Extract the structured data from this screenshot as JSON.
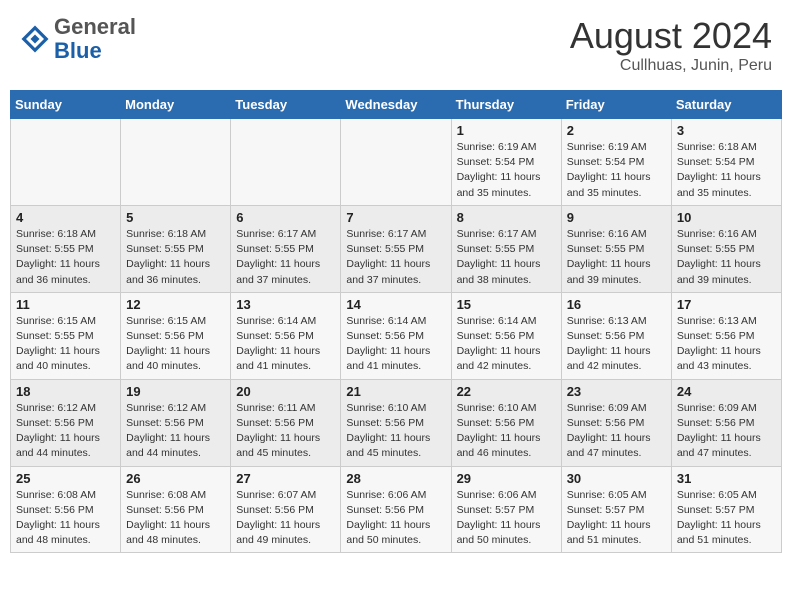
{
  "header": {
    "logo_general": "General",
    "logo_blue": "Blue",
    "month_year": "August 2024",
    "location": "Cullhuas, Junin, Peru"
  },
  "days_of_week": [
    "Sunday",
    "Monday",
    "Tuesday",
    "Wednesday",
    "Thursday",
    "Friday",
    "Saturday"
  ],
  "weeks": [
    [
      {
        "day": "",
        "info": ""
      },
      {
        "day": "",
        "info": ""
      },
      {
        "day": "",
        "info": ""
      },
      {
        "day": "",
        "info": ""
      },
      {
        "day": "1",
        "info": "Sunrise: 6:19 AM\nSunset: 5:54 PM\nDaylight: 11 hours\nand 35 minutes."
      },
      {
        "day": "2",
        "info": "Sunrise: 6:19 AM\nSunset: 5:54 PM\nDaylight: 11 hours\nand 35 minutes."
      },
      {
        "day": "3",
        "info": "Sunrise: 6:18 AM\nSunset: 5:54 PM\nDaylight: 11 hours\nand 35 minutes."
      }
    ],
    [
      {
        "day": "4",
        "info": "Sunrise: 6:18 AM\nSunset: 5:55 PM\nDaylight: 11 hours\nand 36 minutes."
      },
      {
        "day": "5",
        "info": "Sunrise: 6:18 AM\nSunset: 5:55 PM\nDaylight: 11 hours\nand 36 minutes."
      },
      {
        "day": "6",
        "info": "Sunrise: 6:17 AM\nSunset: 5:55 PM\nDaylight: 11 hours\nand 37 minutes."
      },
      {
        "day": "7",
        "info": "Sunrise: 6:17 AM\nSunset: 5:55 PM\nDaylight: 11 hours\nand 37 minutes."
      },
      {
        "day": "8",
        "info": "Sunrise: 6:17 AM\nSunset: 5:55 PM\nDaylight: 11 hours\nand 38 minutes."
      },
      {
        "day": "9",
        "info": "Sunrise: 6:16 AM\nSunset: 5:55 PM\nDaylight: 11 hours\nand 39 minutes."
      },
      {
        "day": "10",
        "info": "Sunrise: 6:16 AM\nSunset: 5:55 PM\nDaylight: 11 hours\nand 39 minutes."
      }
    ],
    [
      {
        "day": "11",
        "info": "Sunrise: 6:15 AM\nSunset: 5:55 PM\nDaylight: 11 hours\nand 40 minutes."
      },
      {
        "day": "12",
        "info": "Sunrise: 6:15 AM\nSunset: 5:56 PM\nDaylight: 11 hours\nand 40 minutes."
      },
      {
        "day": "13",
        "info": "Sunrise: 6:14 AM\nSunset: 5:56 PM\nDaylight: 11 hours\nand 41 minutes."
      },
      {
        "day": "14",
        "info": "Sunrise: 6:14 AM\nSunset: 5:56 PM\nDaylight: 11 hours\nand 41 minutes."
      },
      {
        "day": "15",
        "info": "Sunrise: 6:14 AM\nSunset: 5:56 PM\nDaylight: 11 hours\nand 42 minutes."
      },
      {
        "day": "16",
        "info": "Sunrise: 6:13 AM\nSunset: 5:56 PM\nDaylight: 11 hours\nand 42 minutes."
      },
      {
        "day": "17",
        "info": "Sunrise: 6:13 AM\nSunset: 5:56 PM\nDaylight: 11 hours\nand 43 minutes."
      }
    ],
    [
      {
        "day": "18",
        "info": "Sunrise: 6:12 AM\nSunset: 5:56 PM\nDaylight: 11 hours\nand 44 minutes."
      },
      {
        "day": "19",
        "info": "Sunrise: 6:12 AM\nSunset: 5:56 PM\nDaylight: 11 hours\nand 44 minutes."
      },
      {
        "day": "20",
        "info": "Sunrise: 6:11 AM\nSunset: 5:56 PM\nDaylight: 11 hours\nand 45 minutes."
      },
      {
        "day": "21",
        "info": "Sunrise: 6:10 AM\nSunset: 5:56 PM\nDaylight: 11 hours\nand 45 minutes."
      },
      {
        "day": "22",
        "info": "Sunrise: 6:10 AM\nSunset: 5:56 PM\nDaylight: 11 hours\nand 46 minutes."
      },
      {
        "day": "23",
        "info": "Sunrise: 6:09 AM\nSunset: 5:56 PM\nDaylight: 11 hours\nand 47 minutes."
      },
      {
        "day": "24",
        "info": "Sunrise: 6:09 AM\nSunset: 5:56 PM\nDaylight: 11 hours\nand 47 minutes."
      }
    ],
    [
      {
        "day": "25",
        "info": "Sunrise: 6:08 AM\nSunset: 5:56 PM\nDaylight: 11 hours\nand 48 minutes."
      },
      {
        "day": "26",
        "info": "Sunrise: 6:08 AM\nSunset: 5:56 PM\nDaylight: 11 hours\nand 48 minutes."
      },
      {
        "day": "27",
        "info": "Sunrise: 6:07 AM\nSunset: 5:56 PM\nDaylight: 11 hours\nand 49 minutes."
      },
      {
        "day": "28",
        "info": "Sunrise: 6:06 AM\nSunset: 5:56 PM\nDaylight: 11 hours\nand 50 minutes."
      },
      {
        "day": "29",
        "info": "Sunrise: 6:06 AM\nSunset: 5:57 PM\nDaylight: 11 hours\nand 50 minutes."
      },
      {
        "day": "30",
        "info": "Sunrise: 6:05 AM\nSunset: 5:57 PM\nDaylight: 11 hours\nand 51 minutes."
      },
      {
        "day": "31",
        "info": "Sunrise: 6:05 AM\nSunset: 5:57 PM\nDaylight: 11 hours\nand 51 minutes."
      }
    ]
  ]
}
